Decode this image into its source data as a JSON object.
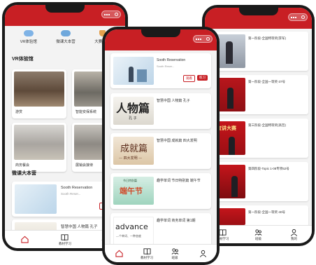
{
  "colors": {
    "brand": "#c81f24",
    "bg": "#f3f3f3"
  },
  "tabbar_full": [
    {
      "label": "",
      "icon": "home-icon"
    },
    {
      "label": "教材学习",
      "icon": "book-icon"
    },
    {
      "label": "班级",
      "icon": "class-icon"
    },
    {
      "label": "",
      "icon": "user-icon"
    }
  ],
  "left": {
    "quick": [
      {
        "label": "VR体验馆",
        "icon": "cloud-icon"
      },
      {
        "label": "微课大本营",
        "icon": "cloud-icon"
      },
      {
        "label": "大赛风采",
        "icon": "trophy-icon"
      }
    ],
    "vr_title": "VR体验馆",
    "vr_items": [
      "",
      "",
      "",
      ""
    ],
    "vr_caps": [
      "游赏",
      "智能安保系统",
      "商务餐会",
      "展销会接待"
    ],
    "micro_title": "微课大本营",
    "card1": {
      "title": "Sooth Reservation",
      "sub": "Sooth Reser...",
      "btn": "观看"
    },
    "card2": {
      "title": "智慧中国 人物篇 孔子"
    },
    "tabs": [
      {
        "label": "",
        "icon": "home-icon"
      },
      {
        "label": "教材学习",
        "icon": "book-icon"
      },
      {
        "label": "班级",
        "icon": "class-icon"
      }
    ]
  },
  "mid": {
    "card1": {
      "title": "Sooth Reservation",
      "sub": "Sooth Reser...",
      "btn1": "观看",
      "btn2": "练习"
    },
    "items": [
      {
        "title": "智慧中国 人物篇 孔子",
        "art": "人物篇",
        "sub_art": "孔 子"
      },
      {
        "title": "智慧中国 成就篇 四大发明",
        "art": "成就篇",
        "sub_art": "— 四大发明 —"
      },
      {
        "title": "趣学单词 节日特别篇 端午节",
        "art": "端午节",
        "sub_art": "节日特别篇"
      },
      {
        "title": "趣学单词 商务单词 第1期",
        "art": "advance",
        "sub_art": "—个单词、一种态度"
      }
    ]
  },
  "right": {
    "items": [
      {
        "text": "第一阶段-全国特等奖(李军)",
        "art": ""
      },
      {
        "text": "第一阶段-全国一等奖-37号",
        "art": ""
      },
      {
        "text": "第三阶段-全国特等奖(高哲)",
        "art": "宣讲大赛"
      },
      {
        "text": "第四阶段-Topic 1-08专项52号",
        "art": ""
      },
      {
        "text": "第一阶段-全国一等奖-40号",
        "art": ""
      }
    ],
    "tabs": [
      {
        "label": "教材学习",
        "icon": "book-icon"
      },
      {
        "label": "班级",
        "icon": "class-icon"
      },
      {
        "label": "我的",
        "icon": "user-icon"
      }
    ]
  }
}
